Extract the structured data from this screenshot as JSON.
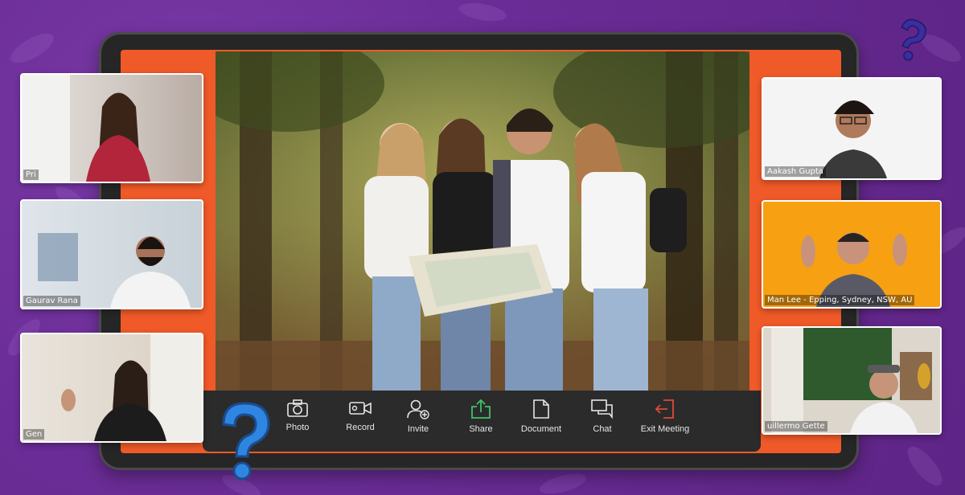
{
  "toolbar": {
    "items": [
      {
        "label": "Photo",
        "icon": "camera-icon"
      },
      {
        "label": "Record",
        "icon": "video-camera-icon"
      },
      {
        "label": "Invite",
        "icon": "add-user-icon"
      },
      {
        "label": "Share",
        "icon": "share-icon"
      },
      {
        "label": "Document",
        "icon": "document-icon"
      },
      {
        "label": "Chat",
        "icon": "chat-icon"
      },
      {
        "label": "Exit Meeting",
        "icon": "exit-icon"
      }
    ]
  },
  "participants": {
    "left": [
      {
        "name": "Pri"
      },
      {
        "name": "Gaurav Rana"
      },
      {
        "name": "Gen"
      }
    ],
    "right": [
      {
        "name": "Aakash Gupta"
      },
      {
        "name": "Man Lee -  Epping, Sydney, NSW, AU"
      },
      {
        "name": "uillermo Gette"
      }
    ]
  },
  "colors": {
    "background": "#6a2c96",
    "accent_orange": "#f05a28",
    "share_green": "#3fc26a",
    "exit_red": "#e2473a",
    "question_blue": "#2f86e0"
  }
}
